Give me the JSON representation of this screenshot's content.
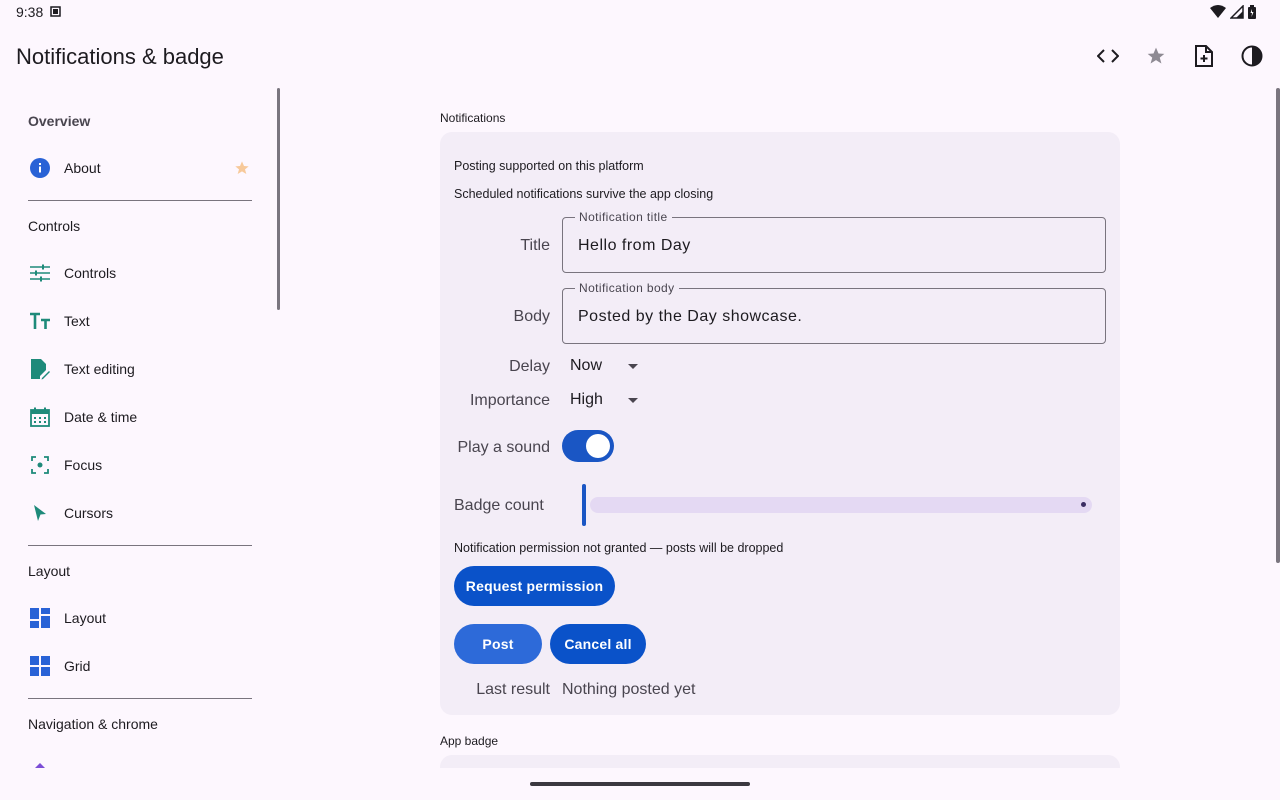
{
  "status": {
    "time": "9:38"
  },
  "app": {
    "title": "Notifications & badge"
  },
  "sidebar": {
    "sections": [
      {
        "label": "Overview"
      },
      {
        "label": "Controls"
      },
      {
        "label": "Layout"
      },
      {
        "label": "Navigation & chrome"
      }
    ],
    "items": [
      {
        "label": "About",
        "icon": "info-icon"
      },
      {
        "label": "Controls",
        "icon": "tune-icon"
      },
      {
        "label": "Text",
        "icon": "text-icon"
      },
      {
        "label": "Text editing",
        "icon": "edit-note-icon"
      },
      {
        "label": "Date & time",
        "icon": "calendar-icon"
      },
      {
        "label": "Focus",
        "icon": "focus-icon"
      },
      {
        "label": "Cursors",
        "icon": "cursor-icon"
      },
      {
        "label": "Layout",
        "icon": "dashboard-icon"
      },
      {
        "label": "Grid",
        "icon": "grid-icon"
      }
    ]
  },
  "notifications": {
    "section_title": "Notifications",
    "info_supported": "Posting supported on this platform",
    "info_survive": "Scheduled notifications survive the app closing",
    "title_label": "Title",
    "title_field_label": "Notification title",
    "title_value": "Hello from Day",
    "body_label": "Body",
    "body_field_label": "Notification body",
    "body_value": "Posted by the Day showcase.",
    "delay_label": "Delay",
    "delay_value": "Now",
    "importance_label": "Importance",
    "importance_value": "High",
    "sound_label": "Play a sound",
    "sound_on": true,
    "badge_label": "Badge count",
    "badge_value": 0,
    "permission_text": "Notification permission not granted — posts will be dropped",
    "request_button": "Request permission",
    "post_button": "Post",
    "cancel_button": "Cancel all",
    "last_result_label": "Last result",
    "last_result_value": "Nothing posted yet"
  },
  "app_badge": {
    "section_title": "App badge"
  },
  "colors": {
    "accent": "#1a56c4",
    "icon_teal": "#1e8a7a",
    "icon_blue": "#2962d6",
    "star": "#f7c99a"
  }
}
